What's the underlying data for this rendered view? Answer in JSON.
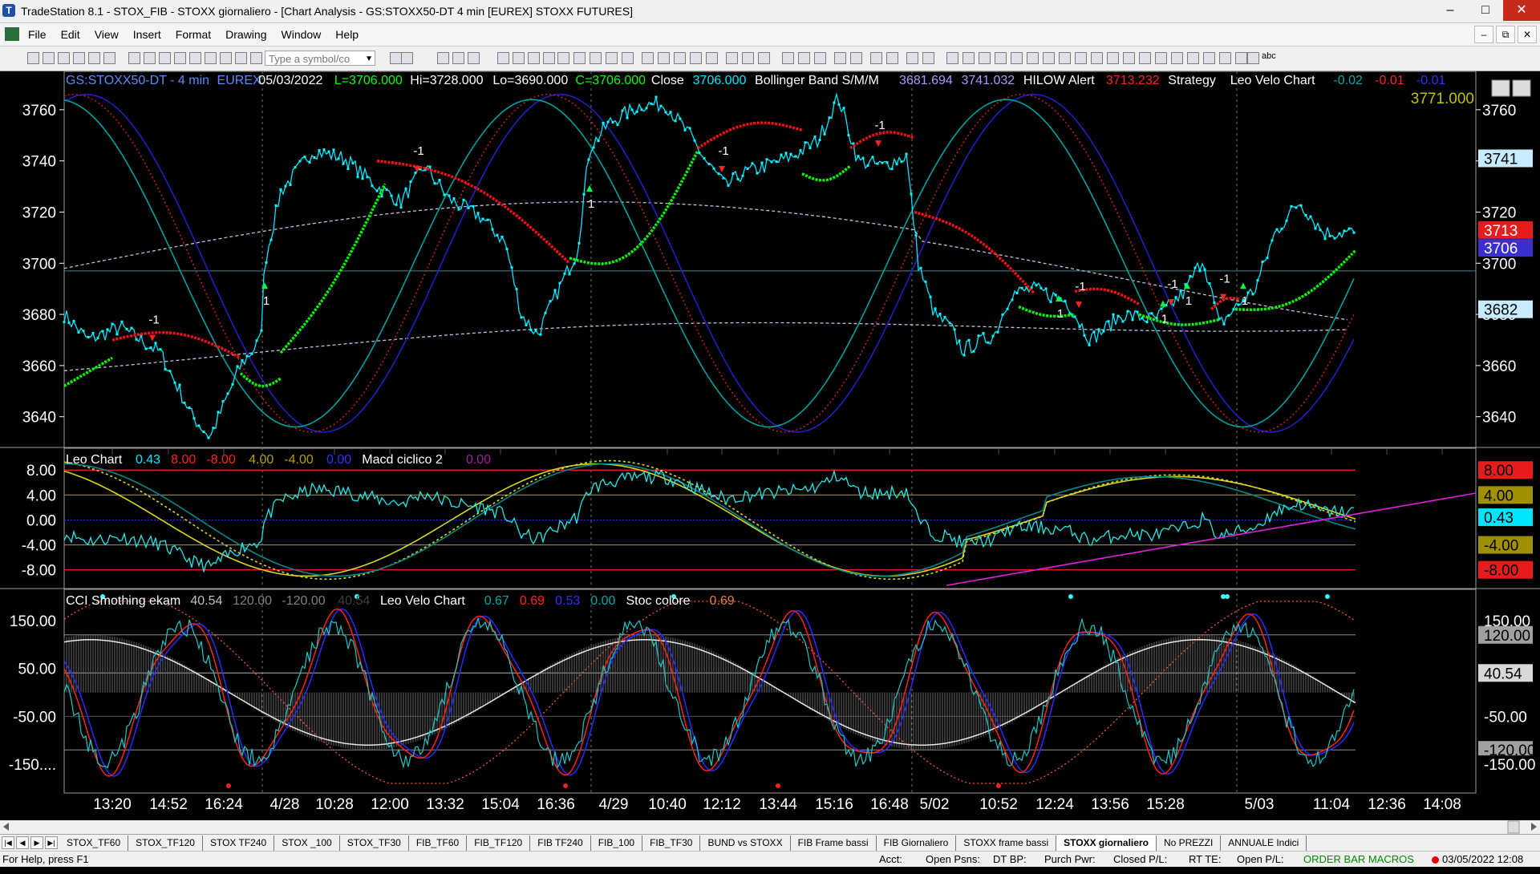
{
  "window": {
    "title": "TradeStation 8.1 - STOX_FIB - STOXX giornaliero - [Chart Analysis - GS:STOXX50-DT  4 min  [EUREX] STOXX FUTURES]",
    "minimize": "–",
    "maximize": "□",
    "close": "✕"
  },
  "menu": [
    "File",
    "Edit",
    "View",
    "Insert",
    "Format",
    "Drawing",
    "Window",
    "Help"
  ],
  "mdi": {
    "minimize": "–",
    "restore": "⧉",
    "close": "✕"
  },
  "toolbar": {
    "symbol_placeholder": "Type a symbol/co",
    "abc_label": "abc"
  },
  "price_pane": {
    "header": [
      {
        "text": "GS:STOXX50-DT - 4 min",
        "color": "#5a8cff"
      },
      {
        "text": "EUREX",
        "color": "#5a8cff"
      },
      {
        "text": "05/03/2022",
        "color": "#ffffff"
      },
      {
        "text": "L=3706.000",
        "color": "#00ff00"
      },
      {
        "text": "Hi=3728.000",
        "color": "#ffffff"
      },
      {
        "text": "Lo=3690.000",
        "color": "#ffffff"
      },
      {
        "text": "C=3706.000",
        "color": "#00ff00"
      },
      {
        "text": "Close",
        "color": "#ffffff"
      },
      {
        "text": "3706.000",
        "color": "#00e5ff"
      },
      {
        "text": "Bollinger Band S/M/M",
        "color": "#ffffff"
      },
      {
        "text": "3681.694",
        "color": "#a0a0ff"
      },
      {
        "text": "3741.032",
        "color": "#a0a0ff"
      },
      {
        "text": "HILOW Alert",
        "color": "#ffffff"
      },
      {
        "text": "3713.232",
        "color": "#ff2020"
      },
      {
        "text": "Strategy",
        "color": "#ffffff"
      },
      {
        "text": "Leo Velo Chart",
        "color": "#ffffff"
      },
      {
        "text": "-0.02",
        "color": "#00a8a8"
      },
      {
        "text": "-0.01",
        "color": "#ff2020"
      },
      {
        "text": "-0.01",
        "color": "#3030ff"
      }
    ],
    "extra_value": "3771.000",
    "y_labels": [
      "3760",
      "3740",
      "3720",
      "3700",
      "3680",
      "3660",
      "3640"
    ],
    "right_labels": [
      {
        "text": "3741",
        "bg": "#c8ecff",
        "fg": "#000000"
      },
      {
        "text": "3713",
        "bg": "#e81c1c",
        "fg": "#ffffff"
      },
      {
        "text": "3706",
        "bg": "#3a30d0",
        "fg": "#ffffff"
      },
      {
        "text": "3682",
        "bg": "#c8ecff",
        "fg": "#000000"
      }
    ],
    "signal_minus": "-1",
    "signal_plus": "1"
  },
  "osc_pane": {
    "header": [
      {
        "text": "Leo Chart",
        "color": "#ffffff"
      },
      {
        "text": "0.43",
        "color": "#00e5ff"
      },
      {
        "text": "8.00",
        "color": "#ff2020"
      },
      {
        "text": "-8.00",
        "color": "#ff2020"
      },
      {
        "text": "4.00",
        "color": "#b0a000"
      },
      {
        "text": "-4.00",
        "color": "#b0a000"
      },
      {
        "text": "0.00",
        "color": "#3030ff"
      },
      {
        "text": "Macd ciclico 2",
        "color": "#ffffff"
      },
      {
        "text": "0.00",
        "color": "#a020a0"
      }
    ],
    "y_labels": [
      "8.00",
      "4.00",
      "0.00",
      "-4.00",
      "-8.00"
    ],
    "right_labels": [
      {
        "text": "8.00",
        "bg": "#e81c1c",
        "fg": "#000000"
      },
      {
        "text": "4.00",
        "bg": "#a09000",
        "fg": "#000000"
      },
      {
        "text": "0.43",
        "bg": "#00e5ff",
        "fg": "#000000"
      },
      {
        "text": "-4.00",
        "bg": "#a09000",
        "fg": "#000000"
      },
      {
        "text": "-8.00",
        "bg": "#e81c1c",
        "fg": "#000000"
      }
    ]
  },
  "cci_pane": {
    "header": [
      {
        "text": "CCI Smothing ekam",
        "color": "#ffffff"
      },
      {
        "text": "40.54",
        "color": "#c0c0c0"
      },
      {
        "text": "120.00",
        "color": "#808080"
      },
      {
        "text": "-120.00",
        "color": "#808080"
      },
      {
        "text": "40.54",
        "color": "#404040"
      },
      {
        "text": "Leo Velo Chart",
        "color": "#ffffff"
      },
      {
        "text": "0.67",
        "color": "#00a8a8"
      },
      {
        "text": "0.69",
        "color": "#ff2020"
      },
      {
        "text": "0.53",
        "color": "#3030ff"
      },
      {
        "text": "0.00",
        "color": "#00a8a8"
      },
      {
        "text": "Stoc colore",
        "color": "#ffffff"
      },
      {
        "text": "0.69",
        "color": "#e08040"
      }
    ],
    "y_labels": [
      "150.00",
      "50.00",
      "-50.00",
      "-150...."
    ],
    "right_labels": [
      {
        "text": "150.00",
        "bg": "#000000",
        "fg": "#ffffff"
      },
      {
        "text": "120.00",
        "bg": "#a0a0a0",
        "fg": "#000000"
      },
      {
        "text": "40.54",
        "bg": "#d8d8d8",
        "fg": "#000000"
      },
      {
        "text": "-50.00",
        "bg": "#000000",
        "fg": "#ffffff"
      },
      {
        "text": "-120.00",
        "bg": "#a0a0a0",
        "fg": "#000000"
      },
      {
        "text": "-150.00",
        "bg": "#000000",
        "fg": "#ffffff"
      }
    ]
  },
  "time_axis": [
    "13:20",
    "14:52",
    "16:24",
    "4/28",
    "10:28",
    "12:00",
    "13:32",
    "15:04",
    "16:36",
    "4/29",
    "10:40",
    "12:12",
    "13:44",
    "15:16",
    "16:48",
    "5/02",
    "10:52",
    "12:24",
    "13:56",
    "15:28",
    "5/03",
    "11:04",
    "12:36",
    "14:08"
  ],
  "tabs": [
    "STOX_TF60",
    "STOX_TF120",
    "STOX TF240",
    "STOX _100",
    "STOX_TF30",
    "FIB_TF60",
    "FIB_TF120",
    "FIB TF240",
    "FIB_100",
    "FIB_TF30",
    "BUND vs STOXX",
    "FIB Frame bassi",
    "FIB Giornaliero",
    "STOXX frame bassi",
    "STOXX giornaliero",
    "No PREZZI",
    "ANNUALE Indici"
  ],
  "active_tab": "STOXX giornaliero",
  "status": {
    "help": "For Help, press F1",
    "acct": "Acct:",
    "open_psns": "Open Psns:",
    "dt_bp": "DT BP:",
    "purch_pwr": "Purch Pwr:",
    "closed_pl": "Closed P/L:",
    "rt_te": "RT TE:",
    "open_pl": "Open P/L:",
    "macros": "ORDER BAR  MACROS",
    "datetime": "03/05/2022 12:08"
  },
  "colors": {
    "price_bars": "#00e5ff",
    "band_blue": "#2020c0",
    "band_red": "#c02020",
    "band_teal": "#00a0a0",
    "bollinger": "#c0c0e0",
    "trail_up": "#00ff00",
    "trail_down": "#ff1010",
    "trend_line": "#e020e0"
  }
}
